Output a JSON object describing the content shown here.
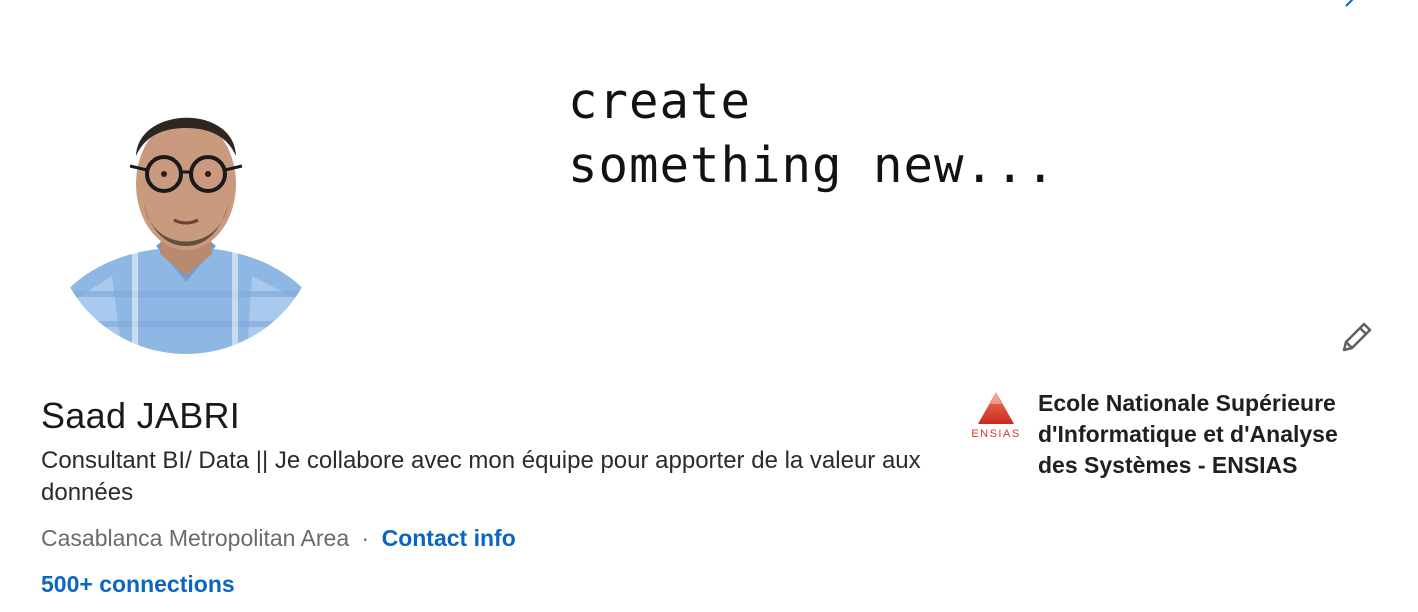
{
  "banner": {
    "line1": "create",
    "line2": "something new..."
  },
  "profile": {
    "name": "Saad JABRI",
    "headline": "Consultant BI/ Data || Je collabore avec mon équipe pour apporter de la valeur aux données",
    "location": "Casablanca Metropolitan Area",
    "separator": "·",
    "contact_info_label": "Contact info",
    "connections_label": "500+ connections"
  },
  "education": {
    "school_name": "Ecole Nationale Supérieure d'Informatique et d'Analyse des Systèmes - ENSIAS",
    "logo_text": "ENSIAS",
    "logo_icon": "ensias-logo-icon"
  },
  "icons": {
    "edit": "pencil-icon"
  },
  "colors": {
    "link": "#0a66c2",
    "text_primary": "#191919",
    "text_secondary": "#6a6a6a",
    "logo_red": "#d23a2a"
  }
}
